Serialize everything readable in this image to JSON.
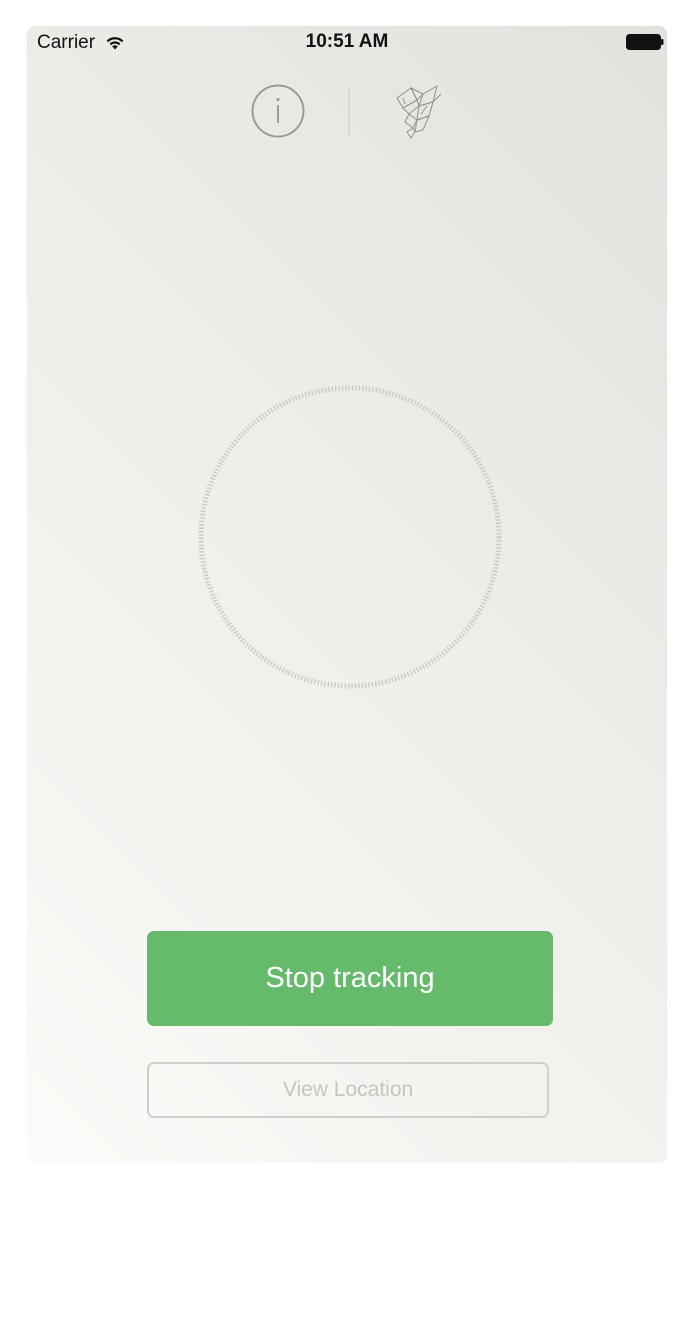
{
  "status_bar": {
    "carrier": "Carrier",
    "time": "10:51 AM",
    "wifi_icon": "wifi-icon",
    "battery_icon": "battery-icon"
  },
  "header": {
    "info_icon": "info-icon",
    "logo_icon": "origami-bird-icon"
  },
  "radar": {
    "icon": "radar-circle-icon"
  },
  "actions": {
    "primary_label": "Stop tracking",
    "secondary_label": "View Location"
  },
  "colors": {
    "primary_button": "#65bb6b",
    "background_gradient_top": "#e2e2dd",
    "background_gradient_bottom": "#fbfbf9",
    "secondary_border": "#cfcfcc",
    "secondary_text": "#c4c4c1"
  }
}
